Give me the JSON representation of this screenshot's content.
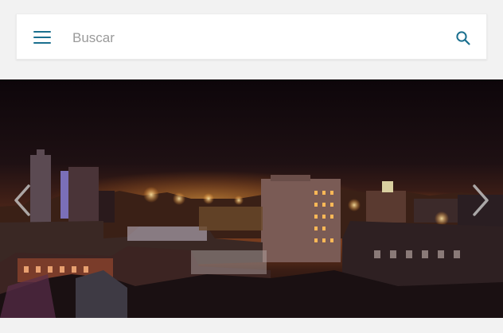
{
  "header": {
    "menu_icon": "hamburger-menu-icon",
    "search": {
      "placeholder": "Buscar",
      "value": "",
      "icon": "search-icon"
    }
  },
  "carousel": {
    "image_description_icon": "city-night-skyline-photo",
    "prev_icon": "chevron-left-icon",
    "next_icon": "chevron-right-icon"
  },
  "colors": {
    "accent": "#1a6f8e",
    "page_background": "#f2f2f2",
    "search_background": "#ffffff",
    "placeholder": "#9a9a9a"
  }
}
